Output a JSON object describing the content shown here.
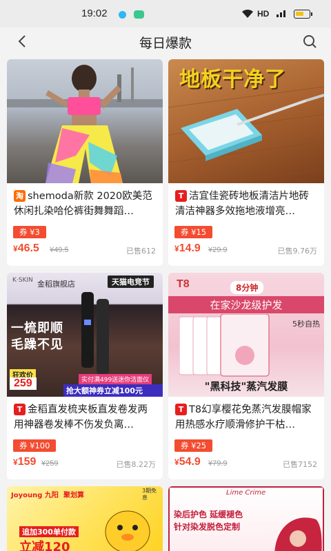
{
  "status_bar": {
    "time": "19:02",
    "network": "HD",
    "signal": "4G"
  },
  "header": {
    "title": "每日爆款"
  },
  "products": [
    {
      "platform": "taobao",
      "platform_icon": "淘",
      "platform_color": "#ff6a00",
      "name": "shemoda新款 2020欧美范休闲扎染哈伦裤街舞舞蹈…",
      "coupon": "券 ¥3",
      "price": "46.5",
      "old_price": "¥49.5",
      "sold": "已售612"
    },
    {
      "platform": "tmall",
      "platform_icon": "T",
      "platform_color": "#e61e1e",
      "name": "洁宜佳瓷砖地板清洁片地砖清洁神器多效拖地液增亮…",
      "coupon": "券 ¥15",
      "price": "14.9",
      "old_price": "¥29.9",
      "sold": "已售9.76万",
      "image_text": "地板干净了"
    },
    {
      "platform": "tmall",
      "platform_icon": "T",
      "platform_color": "#e61e1e",
      "name": "金稻直发梳夹板直发卷发两用神器卷发棒不伤发负离…",
      "coupon": "券 ¥100",
      "price": "159",
      "old_price": "¥259",
      "sold": "已售8.22万",
      "image_text": {
        "brand": "K·SKIN",
        "store": "金稻旗舰店",
        "promo": "天猫电竞节",
        "slogan1": "一梳即顺",
        "slogan2": "毛躁不见",
        "tag": "狂欢价",
        "sale_price": "259",
        "gift": "实付满499送迷你洁面仪",
        "coupon_bar": "抢大额神券立减100元"
      }
    },
    {
      "platform": "tmall",
      "platform_icon": "T",
      "platform_color": "#e61e1e",
      "name": "T8幻享樱花免蒸汽发膜帽家用热感水疗顺滑修护干枯…",
      "coupon": "券 ¥25",
      "price": "54.9",
      "old_price": "¥79.9",
      "sold": "已售7152",
      "image_text": {
        "logo": "T8",
        "minutes": "8分钟",
        "headline": "在家沙龙级护发",
        "feature": "5秒自热",
        "caption": "\"黑科技\"蒸汽发膜"
      }
    },
    {
      "image_text": {
        "brand": "Joyoung 九阳",
        "tag": "聚划算",
        "badge": "3期免息",
        "promo1": "追加300单付款",
        "promo2": "立减120"
      }
    },
    {
      "image_text": {
        "brand": "Lime Crime",
        "line1": "染后护色 延缓褪色",
        "line2": "针对染发脱色定制"
      }
    }
  ]
}
